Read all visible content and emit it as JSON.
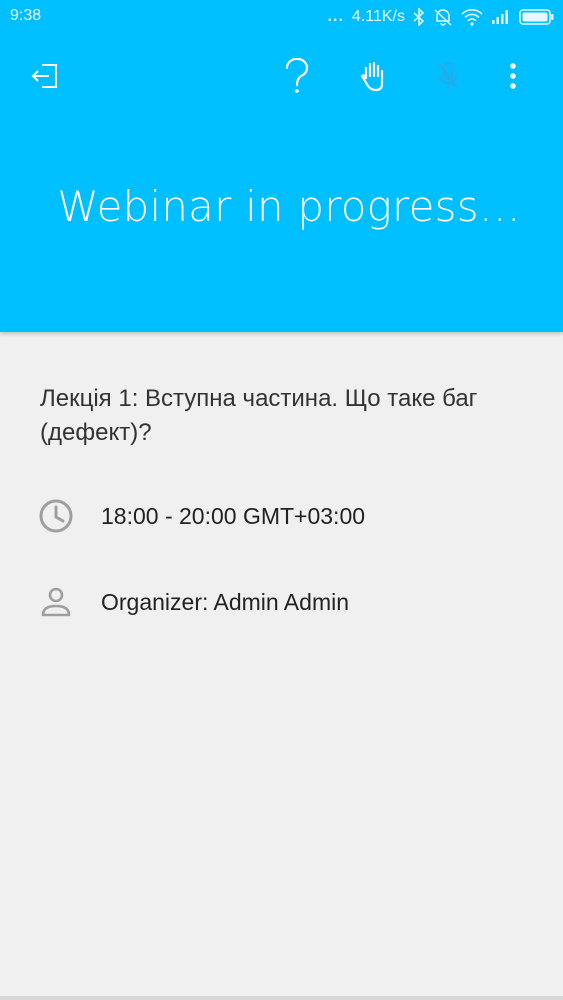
{
  "status_bar": {
    "time": "9:38",
    "dots": "...",
    "net_speed": "4.11K/s",
    "icons": [
      "bluetooth-icon",
      "mute-alarm-icon",
      "wifi-icon",
      "signal-icon",
      "battery-icon"
    ]
  },
  "toolbar": {
    "icons": [
      "exit-icon",
      "help-icon",
      "raise-hand-icon",
      "mic-off-icon",
      "more-vert-icon"
    ]
  },
  "header": {
    "title": "Webinar in progress…",
    "color": "#00bfff"
  },
  "webinar": {
    "title": "Лекція 1: Вступна частина. Що таке баг (дефект)?",
    "time": "18:00 - 20:00 GMT+03:00",
    "organizer": "Organizer: Admin Admin"
  }
}
